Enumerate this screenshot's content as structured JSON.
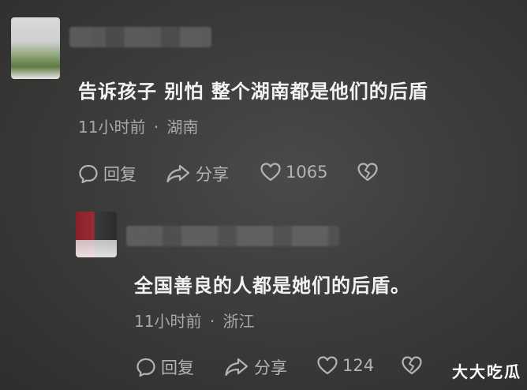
{
  "comment1": {
    "text": "告诉孩子 别怕 整个湖南都是他们的后盾",
    "time": "11小时前",
    "separator": "·",
    "location": "湖南",
    "reply_label": "回复",
    "share_label": "分享",
    "likes": "1065"
  },
  "comment2": {
    "text": "全国善良的人都是她们的后盾。",
    "time": "11小时前",
    "separator": "·",
    "location": "浙江",
    "reply_label": "回复",
    "share_label": "分享",
    "likes": "124"
  },
  "watermark": "大大吃瓜",
  "icons": {
    "reply": "reply-bubble-icon",
    "share": "share-arrow-icon",
    "like": "heart-icon",
    "dislike": "broken-heart-icon"
  },
  "colors": {
    "background": "#3c3c3b",
    "comment_text": "#f2f2f2",
    "meta_text": "#a8a8a8",
    "action_text": "#b3b3b3"
  }
}
